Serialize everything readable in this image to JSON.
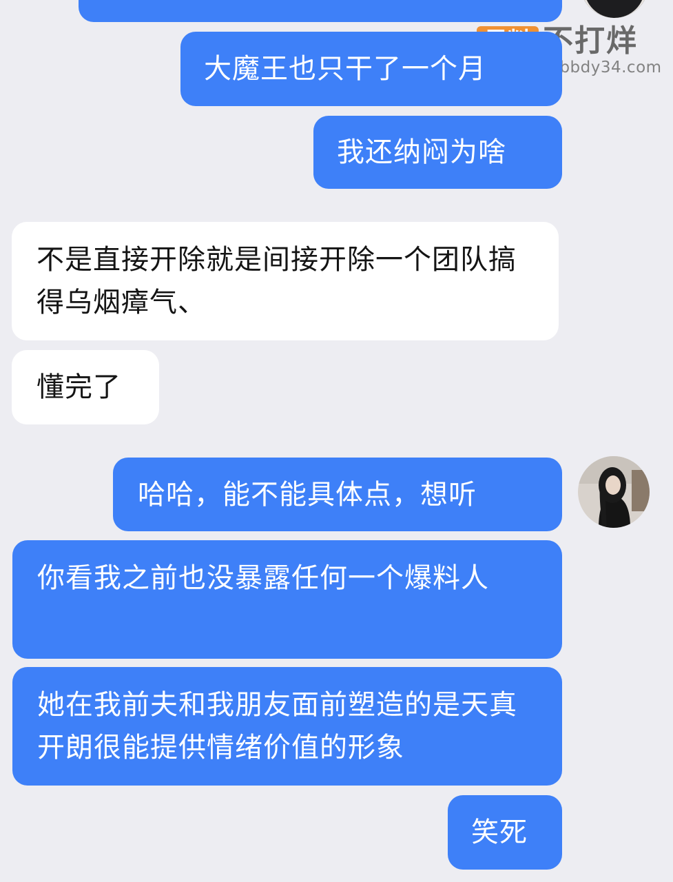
{
  "colors": {
    "background": "#ededf2",
    "outgoing_bubble": "#3e80f8",
    "incoming_bubble": "#ffffff",
    "watermark_badge": "#f08a24"
  },
  "watermark": {
    "badge": "黑料",
    "text": "不打烊",
    "url": "https://bbdy34.com"
  },
  "messages": [
    {
      "direction": "outgoing",
      "text": ""
    },
    {
      "direction": "outgoing",
      "text": "大魔王也只干了一个月"
    },
    {
      "direction": "outgoing",
      "text": "我还纳闷为啥"
    },
    {
      "direction": "incoming",
      "text": "不是直接开除就是间接开除一个团队搞得乌烟瘴气、"
    },
    {
      "direction": "incoming",
      "text": "懂完了"
    },
    {
      "direction": "outgoing",
      "text": "哈哈，能不能具体点，想听"
    },
    {
      "direction": "outgoing",
      "text": "你看我之前也没暴露任何一个爆料人"
    },
    {
      "direction": "outgoing",
      "text": "她在我前夫和我朋友面前塑造的是天真开朗很能提供情绪价值的形象"
    },
    {
      "direction": "outgoing",
      "text": "笑死"
    }
  ]
}
